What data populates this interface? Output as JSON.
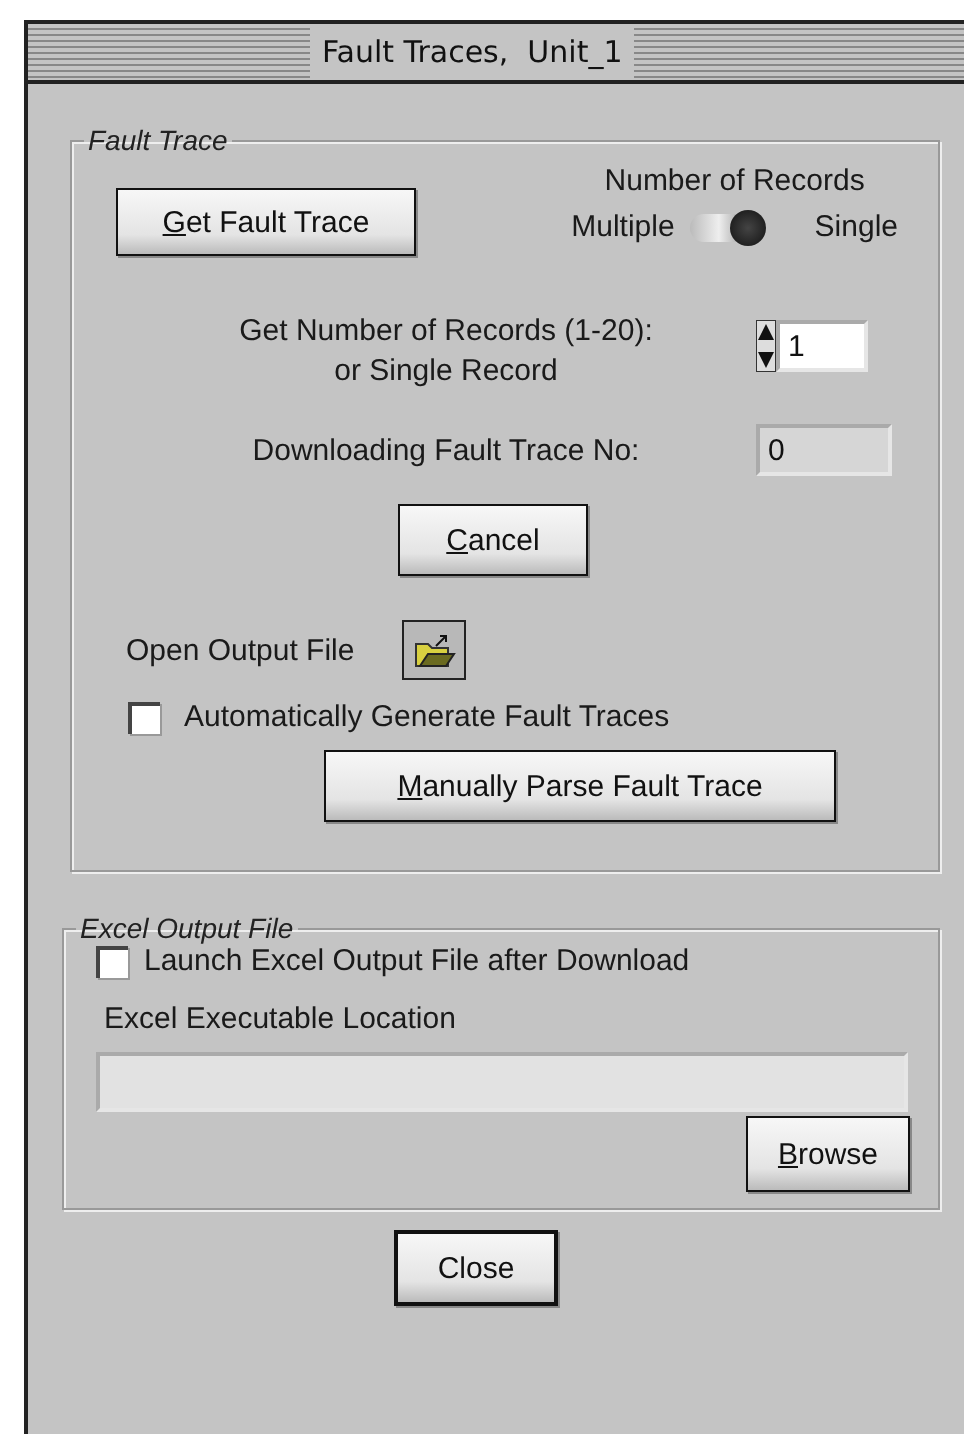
{
  "window": {
    "title": "Fault Traces,  Unit_1"
  },
  "fault_trace": {
    "legend": "Fault Trace",
    "get_button": {
      "accel": "G",
      "rest": "et Fault Trace"
    },
    "records_switch": {
      "title": "Number of Records",
      "left": "Multiple",
      "right": "Single",
      "on": true
    },
    "records_count": {
      "label_lines": [
        "Get Number of Records (1-20):",
        "or Single  Record"
      ],
      "value": "1"
    },
    "downloading": {
      "label": "Downloading Fault Trace No:",
      "value": "0"
    },
    "cancel_button": {
      "accel": "C",
      "rest": "ancel"
    },
    "open_output": {
      "label": "Open Output File"
    },
    "auto_generate": {
      "label": "Automatically Generate Fault Traces",
      "checked": false
    },
    "parse_button": {
      "accel": "M",
      "rest": "anually Parse Fault Trace"
    }
  },
  "excel_output": {
    "legend": "Excel Output File",
    "launch": {
      "label": "Launch Excel Output File after Download",
      "checked": false
    },
    "location_label": "Excel Executable Location",
    "browse_button": {
      "accel": "B",
      "rest": "rowse"
    }
  },
  "close_button": {
    "label": "Close"
  }
}
